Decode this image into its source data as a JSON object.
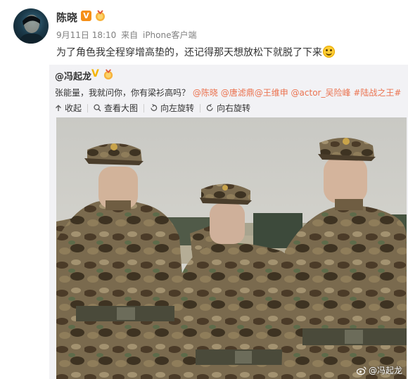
{
  "post": {
    "username": "陈晓",
    "verified_badge": "V",
    "date": "9月11日 18:10",
    "source_prefix": "来自",
    "source": "iPhone客户端",
    "text": "为了角色我全程穿增高垫的，还记得那天想放松下就脱了下来",
    "emoji": "smile-emoji"
  },
  "repost": {
    "author": "@冯起龙",
    "text_plain": "张能量，我就问你，你有梁衫高吗？",
    "mentions": [
      "@陈晓",
      "@唐滤鼎",
      "@王维申",
      "@actor_吴险峰",
      "#陆战之王#"
    ],
    "actions": {
      "collapse": "收起",
      "view_large": "查看大图",
      "rotate_left": "向左旋转",
      "rotate_right": "向右旋转"
    },
    "photo_watermark": "@冯起龙"
  },
  "colors": {
    "link": "#eb7350",
    "repost_bg": "#f2f2f5",
    "verified_orange": "#f58f17",
    "verified_gold": "#f5b400"
  }
}
